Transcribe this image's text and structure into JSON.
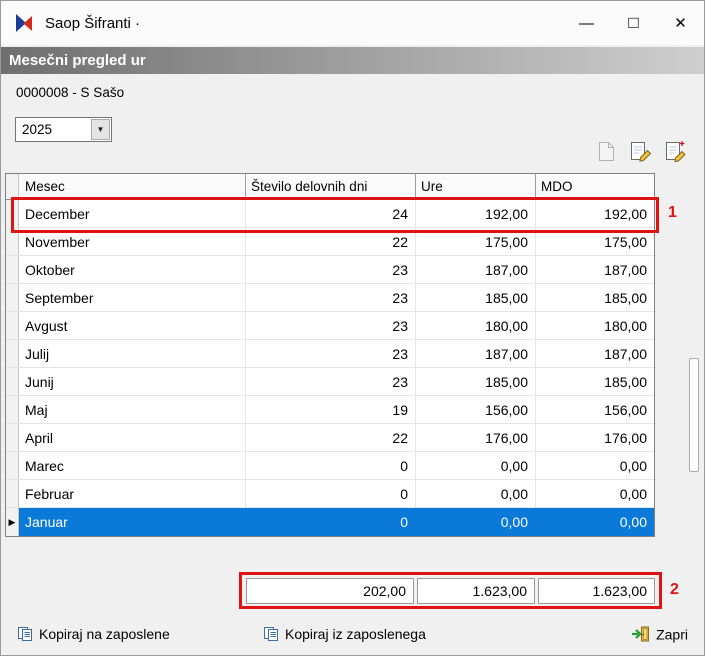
{
  "window": {
    "title": "Saop Šifranti ·",
    "controls": {
      "minimize": "—",
      "maximize": "□",
      "close": "✕"
    }
  },
  "header": {
    "title": "Mesečni pregled ur"
  },
  "employee_label": "0000008 - S Sašo",
  "year_combo": {
    "value": "2025",
    "dropdown_icon": "▼"
  },
  "toolbar": {
    "icons": [
      "copy-record-icon",
      "edit-record-icon",
      "edit-record-extra-icon"
    ]
  },
  "table": {
    "columns": [
      "Mesec",
      "Število delovnih dni",
      "Ure",
      "MDO"
    ],
    "rows": [
      {
        "mesec": "December",
        "dni": "24",
        "ure": "192,00",
        "mdo": "192,00"
      },
      {
        "mesec": "November",
        "dni": "22",
        "ure": "175,00",
        "mdo": "175,00"
      },
      {
        "mesec": "Oktober",
        "dni": "23",
        "ure": "187,00",
        "mdo": "187,00"
      },
      {
        "mesec": "September",
        "dni": "23",
        "ure": "185,00",
        "mdo": "185,00"
      },
      {
        "mesec": "Avgust",
        "dni": "23",
        "ure": "180,00",
        "mdo": "180,00"
      },
      {
        "mesec": "Julij",
        "dni": "23",
        "ure": "187,00",
        "mdo": "187,00"
      },
      {
        "mesec": "Junij",
        "dni": "23",
        "ure": "185,00",
        "mdo": "185,00"
      },
      {
        "mesec": "Maj",
        "dni": "19",
        "ure": "156,00",
        "mdo": "156,00"
      },
      {
        "mesec": "April",
        "dni": "22",
        "ure": "176,00",
        "mdo": "176,00"
      },
      {
        "mesec": "Marec",
        "dni": "0",
        "ure": "0,00",
        "mdo": "0,00"
      },
      {
        "mesec": "Februar",
        "dni": "0",
        "ure": "0,00",
        "mdo": "0,00"
      },
      {
        "mesec": "Januar",
        "dni": "0",
        "ure": "0,00",
        "mdo": "0,00"
      }
    ],
    "selected_row": "Januar",
    "row_marker": "▶"
  },
  "summary": {
    "dni": "202,00",
    "ure": "1.623,00",
    "mdo": "1.623,00"
  },
  "annotations": {
    "row_highlight_label": "1",
    "summary_highlight_label": "2"
  },
  "footer": {
    "buttons": [
      {
        "label": "Kopiraj na zaposlene"
      },
      {
        "label": "Kopiraj iz zaposlenega"
      },
      {
        "label": "Zapri"
      }
    ]
  },
  "colors": {
    "selected-row": "#0b79d8",
    "annotation": "#e01212",
    "header-gradient-start": "#6f6f6f",
    "header-gradient-end": "#cfcfcf"
  }
}
